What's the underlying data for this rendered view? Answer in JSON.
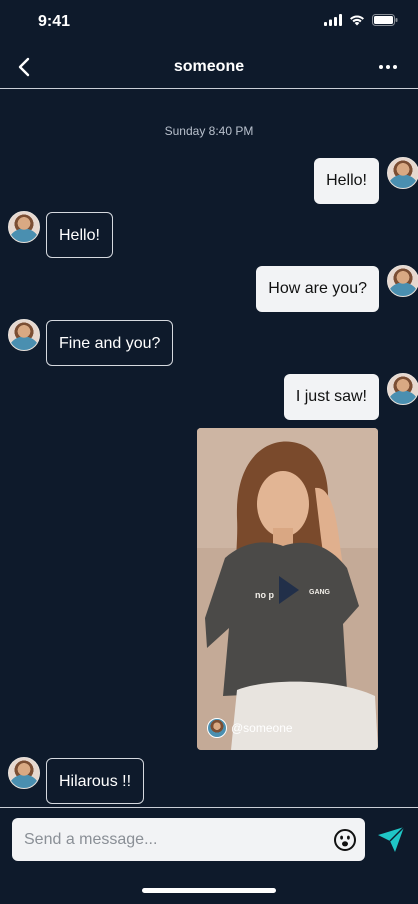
{
  "status_bar": {
    "time": "9:41"
  },
  "header": {
    "title": "someone"
  },
  "conversation": {
    "timestamp": "Sunday 8:40 PM",
    "messages": [
      {
        "side": "out",
        "text": "Hello!"
      },
      {
        "side": "in",
        "text": "Hello!"
      },
      {
        "side": "out",
        "text": "How are you?"
      },
      {
        "side": "in",
        "text": "Fine and you?"
      },
      {
        "side": "out",
        "text": "I just saw!"
      },
      {
        "side": "in",
        "text": "Hilarous !!"
      }
    ],
    "shared_video": {
      "handle": "@someone",
      "shirt_text": "no p... GANG"
    }
  },
  "composer": {
    "placeholder": "Send a message..."
  },
  "colors": {
    "background": "#0e1a2b",
    "send_accent": "#1fc6c6",
    "outgoing_bubble": "#f2f3f5"
  },
  "icons": [
    "back-chevron-icon",
    "more-dots-icon",
    "emoji-icon",
    "send-icon",
    "signal-icon",
    "wifi-icon",
    "battery-icon",
    "play-icon"
  ]
}
